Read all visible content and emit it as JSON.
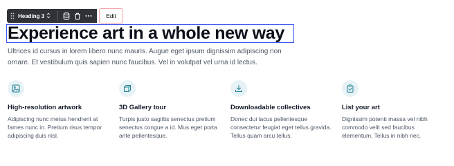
{
  "toolbar": {
    "block_type": "Heading 3",
    "edit_label": "Edit"
  },
  "heading": "Experience art in a whole new way",
  "intro": "Ultrices id cursus in lorem libero nunc mauris. Augue eget ipsum dignissim adipiscing non ornare. Et vestibulum quis sapien nunc faucibus. Vel in volutpat vel urna id lectus.",
  "features": [
    {
      "icon": "image-icon",
      "title": "High-resolution artwork",
      "desc": "Adipiscing nunc metus hendrerit at fames nunc in. Pretium risus tempor adipiscing duis nisl."
    },
    {
      "icon": "cube-icon",
      "title": "3D Gallery tour",
      "desc": "Turpis justo sagittis senectus pretium senectus congue a id. Mus eget porta ante pellentesque."
    },
    {
      "icon": "download-icon",
      "title": "Downloadable collectives",
      "desc": "Donec dui lacus pellentesque consectetur feugiat eget tellus gravida. Tellus quam arcu tellus."
    },
    {
      "icon": "clipboard-check-icon",
      "title": "List your art",
      "desc": "Dignissim potenti massa vel nibh commodo velit sed faucibus elementum. Tellus in nibh nec."
    }
  ],
  "colors": {
    "accent_blue": "#3d5af1",
    "edit_border": "#f4a0a6",
    "icon_bg": "#e6f2f5",
    "icon_fg": "#1e7f94",
    "toolbar_bg": "#2f3338"
  }
}
